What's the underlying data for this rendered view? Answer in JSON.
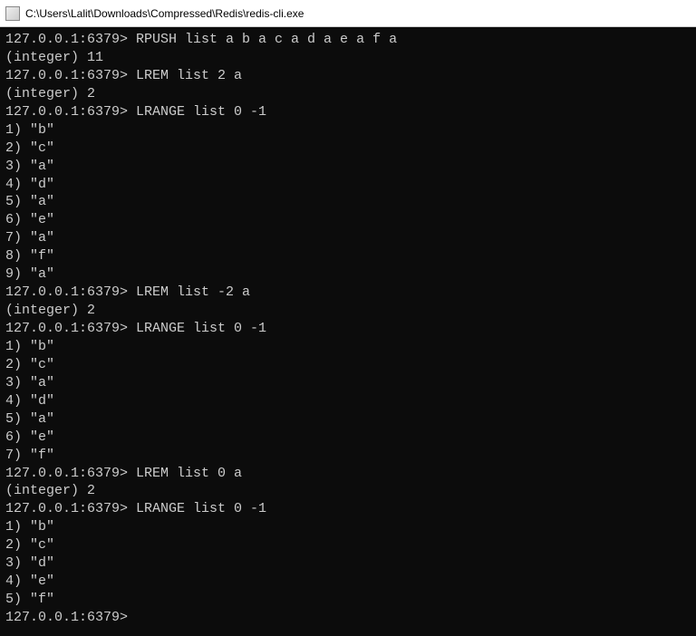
{
  "titlebar": {
    "text": "C:\\Users\\Lalit\\Downloads\\Compressed\\Redis\\redis-cli.exe"
  },
  "prompt": "127.0.0.1:6379>",
  "lines": [
    {
      "type": "cmd",
      "text": "127.0.0.1:6379> RPUSH list a b a c a d a e a f a"
    },
    {
      "type": "out",
      "text": "(integer) 11"
    },
    {
      "type": "cmd",
      "text": "127.0.0.1:6379> LREM list 2 a"
    },
    {
      "type": "out",
      "text": "(integer) 2"
    },
    {
      "type": "cmd",
      "text": "127.0.0.1:6379> LRANGE list 0 -1"
    },
    {
      "type": "out",
      "text": "1) \"b\""
    },
    {
      "type": "out",
      "text": "2) \"c\""
    },
    {
      "type": "out",
      "text": "3) \"a\""
    },
    {
      "type": "out",
      "text": "4) \"d\""
    },
    {
      "type": "out",
      "text": "5) \"a\""
    },
    {
      "type": "out",
      "text": "6) \"e\""
    },
    {
      "type": "out",
      "text": "7) \"a\""
    },
    {
      "type": "out",
      "text": "8) \"f\""
    },
    {
      "type": "out",
      "text": "9) \"a\""
    },
    {
      "type": "cmd",
      "text": "127.0.0.1:6379> LREM list -2 a"
    },
    {
      "type": "out",
      "text": "(integer) 2"
    },
    {
      "type": "cmd",
      "text": "127.0.0.1:6379> LRANGE list 0 -1"
    },
    {
      "type": "out",
      "text": "1) \"b\""
    },
    {
      "type": "out",
      "text": "2) \"c\""
    },
    {
      "type": "out",
      "text": "3) \"a\""
    },
    {
      "type": "out",
      "text": "4) \"d\""
    },
    {
      "type": "out",
      "text": "5) \"a\""
    },
    {
      "type": "out",
      "text": "6) \"e\""
    },
    {
      "type": "out",
      "text": "7) \"f\""
    },
    {
      "type": "cmd",
      "text": "127.0.0.1:6379> LREM list 0 a"
    },
    {
      "type": "out",
      "text": "(integer) 2"
    },
    {
      "type": "cmd",
      "text": "127.0.0.1:6379> LRANGE list 0 -1"
    },
    {
      "type": "out",
      "text": "1) \"b\""
    },
    {
      "type": "out",
      "text": "2) \"c\""
    },
    {
      "type": "out",
      "text": "3) \"d\""
    },
    {
      "type": "out",
      "text": "4) \"e\""
    },
    {
      "type": "out",
      "text": "5) \"f\""
    },
    {
      "type": "cmd",
      "text": "127.0.0.1:6379>"
    }
  ]
}
